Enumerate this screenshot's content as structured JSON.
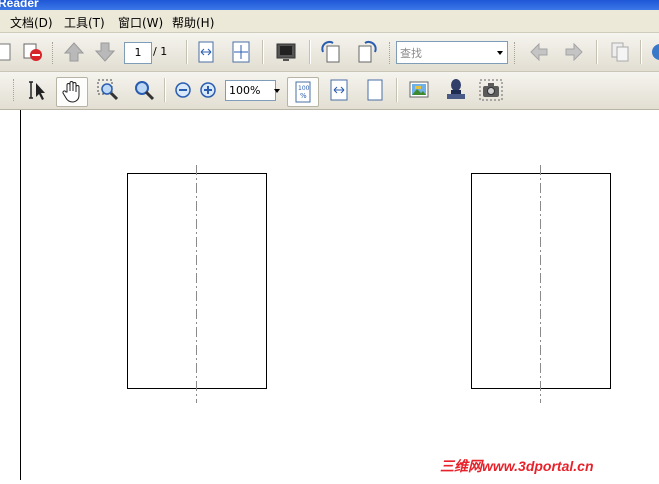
{
  "window": {
    "title": "Reader"
  },
  "menu": {
    "items": [
      "文档(D)",
      "工具(T)",
      "窗口(W)",
      "帮助(H)"
    ]
  },
  "toolbar": {
    "page_current": "1",
    "page_total": "/ 1",
    "search_placeholder": "查找",
    "zoom_value": "100%"
  },
  "icons": {
    "new": "new-document-icon",
    "delete": "delete-icon",
    "prev": "previous-page-icon",
    "next": "next-page-icon",
    "fit_width": "fit-width-icon",
    "fit_page": "fit-page-icon",
    "fullscreen": "full-screen-icon",
    "rotate_ccw": "rotate-counterclockwise-icon",
    "rotate_cw": "rotate-clockwise-icon",
    "back": "back-icon",
    "forward": "forward-icon",
    "copy": "copy-icon",
    "text_select": "text-select-icon",
    "hand": "hand-tool-icon",
    "zoom_marquee": "marquee-zoom-icon",
    "zoom_tool": "zoom-tool-icon",
    "zoom_out": "zoom-out-icon",
    "zoom_in": "zoom-in-icon",
    "actual_size": "actual-size-icon",
    "fit_width2": "fit-width-icon",
    "single_page": "single-page-icon",
    "image": "image-icon",
    "stamp": "stamp-icon",
    "snapshot": "snapshot-icon"
  },
  "watermark": "三维网www.3dportal.cn"
}
